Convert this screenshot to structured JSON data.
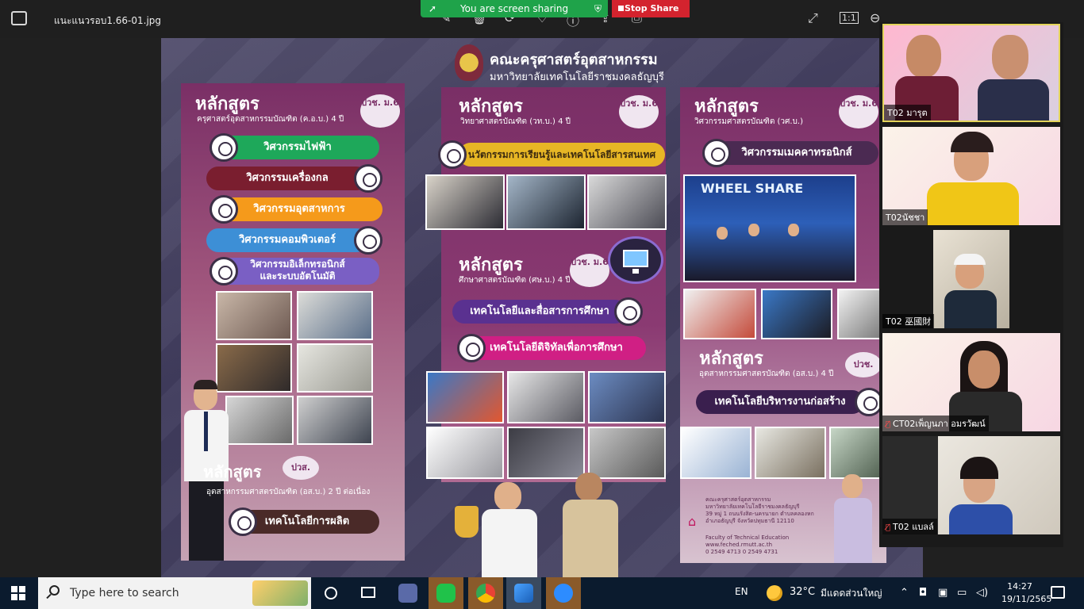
{
  "window": {
    "filename": "แนะแนวรอบ1.66-01.jpg"
  },
  "share": {
    "status": "You are screen sharing",
    "stop_label": "Stop Share"
  },
  "poster": {
    "faculty": "คณะครุศาสตร์อุตสาหกรรม",
    "university": "มหาวิทยาลัยเทคโนโลยีราชมงคลธัญบุรี",
    "col1": {
      "title": "หลักสูตร",
      "subtitle": "ครุศาสตร์อุตสาหกรรมบัณฑิต (ค.อ.บ.) 4 ปี",
      "badge": "ปวช. ม.6",
      "programs": [
        "วิศวกรรมไฟฟ้า",
        "วิศวกรรมเครื่องกล",
        "วิศวกรรมอุตสาหการ",
        "วิศวกรรมคอมพิวเตอร์",
        "วิศวกรรมอิเล็กทรอนิกส์",
        "และระบบอัตโนมัติ"
      ],
      "sec2_title": "หลักสูตร",
      "sec2_badge": "ปวส.",
      "sec2_subtitle": "อุตสาหกรรมศาสตรบัณฑิต (อส.บ.) 2 ปี ต่อเนื่อง",
      "sec2_program": "เทคโนโลยีการผลิต"
    },
    "col2": {
      "title": "หลักสูตร",
      "subtitle": "วิทยาศาสตรบัณฑิต (วท.บ.) 4 ปี",
      "badge": "ปวช. ม.6",
      "program": "นวัตกรรมการเรียนรู้และเทคโนโลยีสารสนเทศ",
      "sec2_title": "หลักสูตร",
      "sec2_subtitle": "ศึกษาศาสตรบัณฑิต (ศษ.บ.) 4 ปี",
      "sec2_badge": "ปวช. ม.6",
      "sec2_programs": [
        "เทคโนโลยีและสื่อสารการศึกษา",
        "เทคโนโลยีดิจิทัลเพื่อการศึกษา"
      ]
    },
    "col3": {
      "title": "หลักสูตร",
      "subtitle": "วิศวกรรมศาสตรบัณฑิต (วศ.บ.)",
      "badge": "ปวช. ม.6",
      "program": "วิศวกรรมเมคคาทรอนิกส์",
      "photo_banner": "WHEEL SHARE",
      "sec2_title": "หลักสูตร",
      "sec2_subtitle": "อุตสาหกรรมศาสตรบัณฑิต (อส.บ.) 4 ปี",
      "sec2_badge": "ปวช.",
      "sec2_program": "เทคโนโลยีบริหารงานก่อสร้าง",
      "contact_faculty": "คณะครุศาสตร์อุตสาหกรรม",
      "contact_univ": "มหาวิทยาลัยเทคโนโลยีราชมงคลธัญบุรี",
      "contact_addr1": "39 หมู่ 1 ถนนรังสิต-นครนายก ตำบลคลองหก",
      "contact_addr2": "อำเภอธัญบุรี จังหวัดปทุมธานี 12110",
      "contact_en": "Faculty of Technical Education",
      "contact_web": "www.feched.rmutt.ac.th",
      "contact_phone": "0 2549 4713  0 2549 4731"
    }
  },
  "participants": [
    {
      "name": "T02 มารุต",
      "muted": false
    },
    {
      "name": "T02นัชชา",
      "muted": false
    },
    {
      "name": "T02 巫國財",
      "muted": false
    },
    {
      "name": "CT02เพ็ญนภา  อมรวัฒน์",
      "muted": true
    },
    {
      "name": "T02 แบลล์",
      "muted": true
    }
  ],
  "taskbar": {
    "search_placeholder": "Type here to search",
    "lang": "EN",
    "temp": "32°C",
    "weather": "มีแดดส่วนใหญ่",
    "time": "14:27",
    "date": "19/11/2565"
  },
  "colors": {
    "share_green": "#1fa34a",
    "stop_red": "#d3232e",
    "taskbar": "#0b1b2e"
  }
}
